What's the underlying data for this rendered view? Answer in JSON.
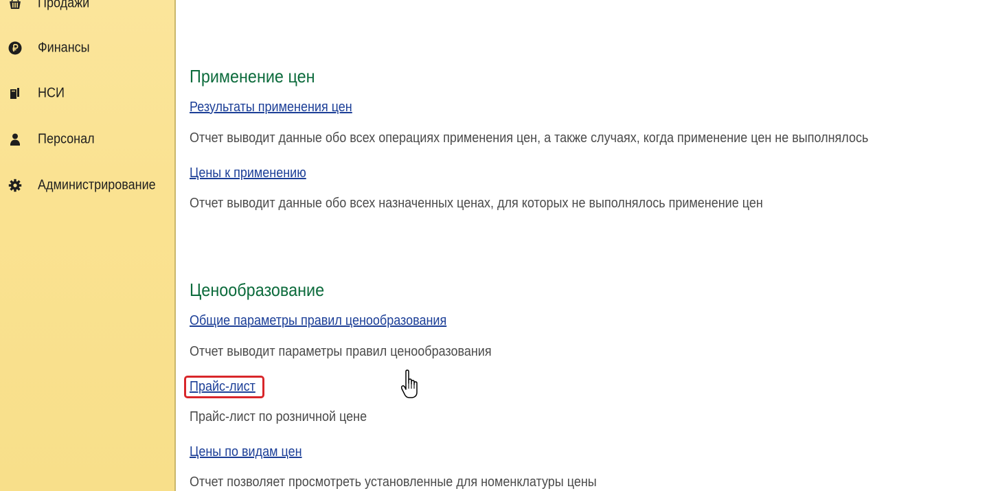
{
  "sidebar": {
    "items": [
      {
        "label": "Продажи",
        "icon": "basket-icon"
      },
      {
        "label": "Финансы",
        "icon": "ruble-coin-icon"
      },
      {
        "label": "НСИ",
        "icon": "books-icon"
      },
      {
        "label": "Персонал",
        "icon": "person-icon"
      },
      {
        "label": "Администрирование",
        "icon": "gear-icon"
      }
    ]
  },
  "main": {
    "sections": [
      {
        "title": "Применение цен",
        "reports": [
          {
            "link": "Результаты применения цен",
            "description": "Отчет выводит данные обо всех операциях применения цен, а также случаях, когда применение цен не выполнялось"
          },
          {
            "link": "Цены к применению",
            "description": "Отчет выводит данные обо всех назначенных ценах, для которых не выполнялось применение цен"
          }
        ]
      },
      {
        "title": "Ценообразование",
        "reports": [
          {
            "link": "Общие параметры правил ценообразования",
            "description": "Отчет выводит параметры правил ценообразования"
          },
          {
            "link": "Прайс-лист",
            "description": "Прайс-лист по розничной цене",
            "highlighted": true
          },
          {
            "link": "Цены по видам цен",
            "description": "Отчет позволяет просмотреть установленные для номенклатуры цены"
          }
        ]
      }
    ]
  },
  "colors": {
    "sidebar_bg": "#fae291",
    "section_title": "#0c6b3c",
    "link": "#1b3e97",
    "description": "#4a4a4a",
    "highlight": "#d8262a"
  }
}
